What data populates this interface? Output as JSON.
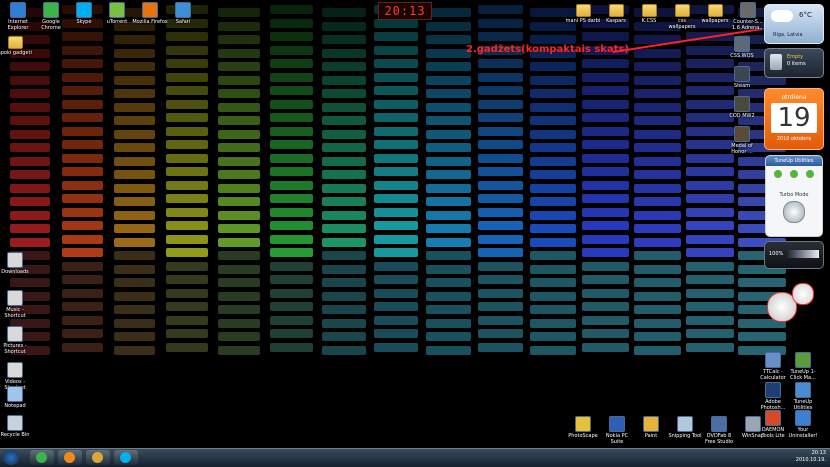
{
  "desktop": {
    "clock_gadget": {
      "time": "20:13"
    },
    "annotation": {
      "text": "2.gadžets(kompaktais skats)",
      "color": "#ff2222"
    },
    "icons_top_left": [
      {
        "name": "internet-explorer-icon",
        "label": "Internet Explorer",
        "type": "app",
        "color": "#2f7fd6"
      },
      {
        "name": "google-chrome-icon",
        "label": "Google Chrome",
        "type": "app",
        "color": "#3bb54a"
      },
      {
        "name": "skype-icon",
        "label": "Skype",
        "type": "app",
        "color": "#00aff0"
      },
      {
        "name": "utorrent-icon",
        "label": "uTorrent",
        "type": "app",
        "color": "#78c043"
      },
      {
        "name": "mozilla-firefox-icon",
        "label": "Mozilla Firefox",
        "type": "app",
        "color": "#e8730c"
      },
      {
        "name": "safari-icon",
        "label": "Safari",
        "type": "app",
        "color": "#3d8fd6"
      }
    ],
    "icons_left_column": [
      {
        "name": "spoki-gadgets-folder-icon",
        "label": "spoki gadgeti",
        "type": "folder"
      },
      {
        "name": "downloads-shortcut-icon",
        "label": "Downloads",
        "type": "app",
        "color": "#d9d9d9"
      },
      {
        "name": "music-shortcut-icon",
        "label": "Music - Shortcut",
        "type": "app",
        "color": "#d9d9d9"
      },
      {
        "name": "pictures-shortcut-icon",
        "label": "Pictures - Shortcut",
        "type": "app",
        "color": "#d9d9d9"
      },
      {
        "name": "videos-shortcut-icon",
        "label": "Videos - Shortcut",
        "type": "app",
        "color": "#d9d9d9"
      },
      {
        "name": "notepad-icon",
        "label": "Notepad",
        "type": "app",
        "color": "#9fc6ea"
      },
      {
        "name": "recycle-bin-icon",
        "label": "Recycle Bin",
        "type": "app",
        "color": "#c8d2dc"
      }
    ],
    "icons_top_right": [
      {
        "name": "mani-ps-darbi-folder-icon",
        "label": "mani PS darbi",
        "type": "folder"
      },
      {
        "name": "kaspars-folder-icon",
        "label": "Kaspars",
        "type": "folder"
      },
      {
        "name": "k-css-folder-icon",
        "label": "K.CSS",
        "type": "folder"
      },
      {
        "name": "css-wallpapers-folder-icon",
        "label": "css wallpapers",
        "type": "folder"
      },
      {
        "name": "wallpapers-folder-icon",
        "label": "wallpapers",
        "type": "folder"
      },
      {
        "name": "counter-strike-icon",
        "label": "Counter-S... 1.6 Adrena...",
        "type": "app",
        "color": "#6a6a6a"
      }
    ],
    "icons_right_column": [
      {
        "name": "css-wos-icon",
        "label": "CSS.WOS",
        "type": "app",
        "color": "#5a6a7a"
      },
      {
        "name": "steam-icon",
        "label": "Steam",
        "type": "app",
        "color": "#3a4654"
      },
      {
        "name": "cod-mw2-icon",
        "label": "COD MW2",
        "type": "app",
        "color": "#4a4a3a"
      },
      {
        "name": "medal-of-honor-icon",
        "label": "Medal of Honor ...",
        "type": "app",
        "color": "#5b4a34"
      }
    ],
    "icons_bottom_right": [
      {
        "name": "ttcalc-icon",
        "label": "TTCalc - Calculator",
        "type": "app",
        "color": "#6a8fc8"
      },
      {
        "name": "tuneup-1-click-icon",
        "label": "TuneUp 1-Click Ma...",
        "type": "app",
        "color": "#5d9c3a"
      },
      {
        "name": "adobe-photoshop-icon",
        "label": "Adobe Photosh...",
        "type": "app",
        "color": "#1f3f74"
      },
      {
        "name": "tuneup-utilities-icon",
        "label": "TuneUp Utilities",
        "type": "app",
        "color": "#4d8bd0"
      },
      {
        "name": "daemon-tools-icon",
        "label": "DAEMON Tools Lite",
        "type": "app",
        "color": "#d64a2a"
      },
      {
        "name": "your-uninstaller-icon",
        "label": "Your Uninstaller!",
        "type": "app",
        "color": "#3f7fd1"
      }
    ],
    "icons_bottom_row": [
      {
        "name": "photoscape-icon",
        "label": "PhotoScape",
        "type": "app",
        "color": "#e6c13a"
      },
      {
        "name": "nokia-pc-suite-icon",
        "label": "Nokia PC Suite",
        "type": "app",
        "color": "#2d5fb5"
      },
      {
        "name": "paint-icon",
        "label": "Paint",
        "type": "app",
        "color": "#e8b23a"
      },
      {
        "name": "snipping-tool-icon",
        "label": "Snipping Tool",
        "type": "app",
        "color": "#b5c7da"
      },
      {
        "name": "dvdfab-icon",
        "label": "DVDFab 8 Free Studio",
        "type": "app",
        "color": "#4a6ea8"
      },
      {
        "name": "windsap-icon",
        "label": "WinSnap",
        "type": "app",
        "color": "#9aa6b2"
      }
    ]
  },
  "gadgets": {
    "weather": {
      "location": "Riga, Latvia",
      "temp": "6°C"
    },
    "recycle": {
      "title": "Empty",
      "subtitle": "0 items"
    },
    "calendar": {
      "weekday": "otrdiena",
      "day": "19",
      "month_year": "2010 oktobris"
    },
    "tuneup": {
      "title": "TuneUp Utilities",
      "mode": "Turbo Mode"
    },
    "meter": {
      "value": "100%"
    }
  },
  "taskbar": {
    "apps": [
      {
        "name": "start-button",
        "color": "#2e6fb8"
      },
      {
        "name": "taskbar-chrome-icon",
        "color": "#3bb54a"
      },
      {
        "name": "taskbar-vlc-icon",
        "color": "#f08a1c"
      },
      {
        "name": "taskbar-explorer-icon",
        "color": "#d8a83a"
      },
      {
        "name": "taskbar-skype-icon",
        "color": "#00aff0"
      }
    ],
    "clock": {
      "time": "20:13",
      "date": "2010.10.19."
    }
  }
}
